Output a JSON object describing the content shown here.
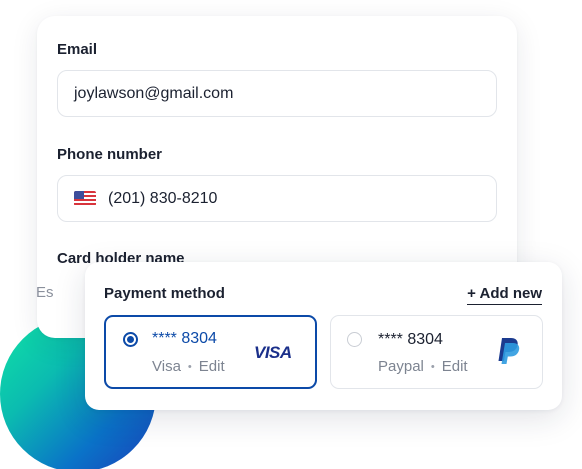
{
  "form": {
    "email_label": "Email",
    "email_value": "joylawson@gmail.com",
    "phone_label": "Phone number",
    "phone_value": "(201) 830-8210",
    "card_holder_label": "Card holder name",
    "partial_field_text": "Es"
  },
  "payment": {
    "title": "Payment method",
    "add_new_label": "+ Add new",
    "options": [
      {
        "number": "**** 8304",
        "type": "Visa",
        "edit": "Edit",
        "brand": "VISA",
        "selected": true
      },
      {
        "number": "**** 8304",
        "type": "Paypal",
        "edit": "Edit",
        "brand_icon": "paypal-icon",
        "selected": false
      }
    ]
  },
  "colors": {
    "accent": "#0c4aa8",
    "visa_brand": "#1a2f8a",
    "paypal_dark": "#1b3b8f",
    "paypal_light": "#2d9be0",
    "gradient": [
      "#10e3a5",
      "#0a72c8",
      "#1b3fb8"
    ]
  }
}
